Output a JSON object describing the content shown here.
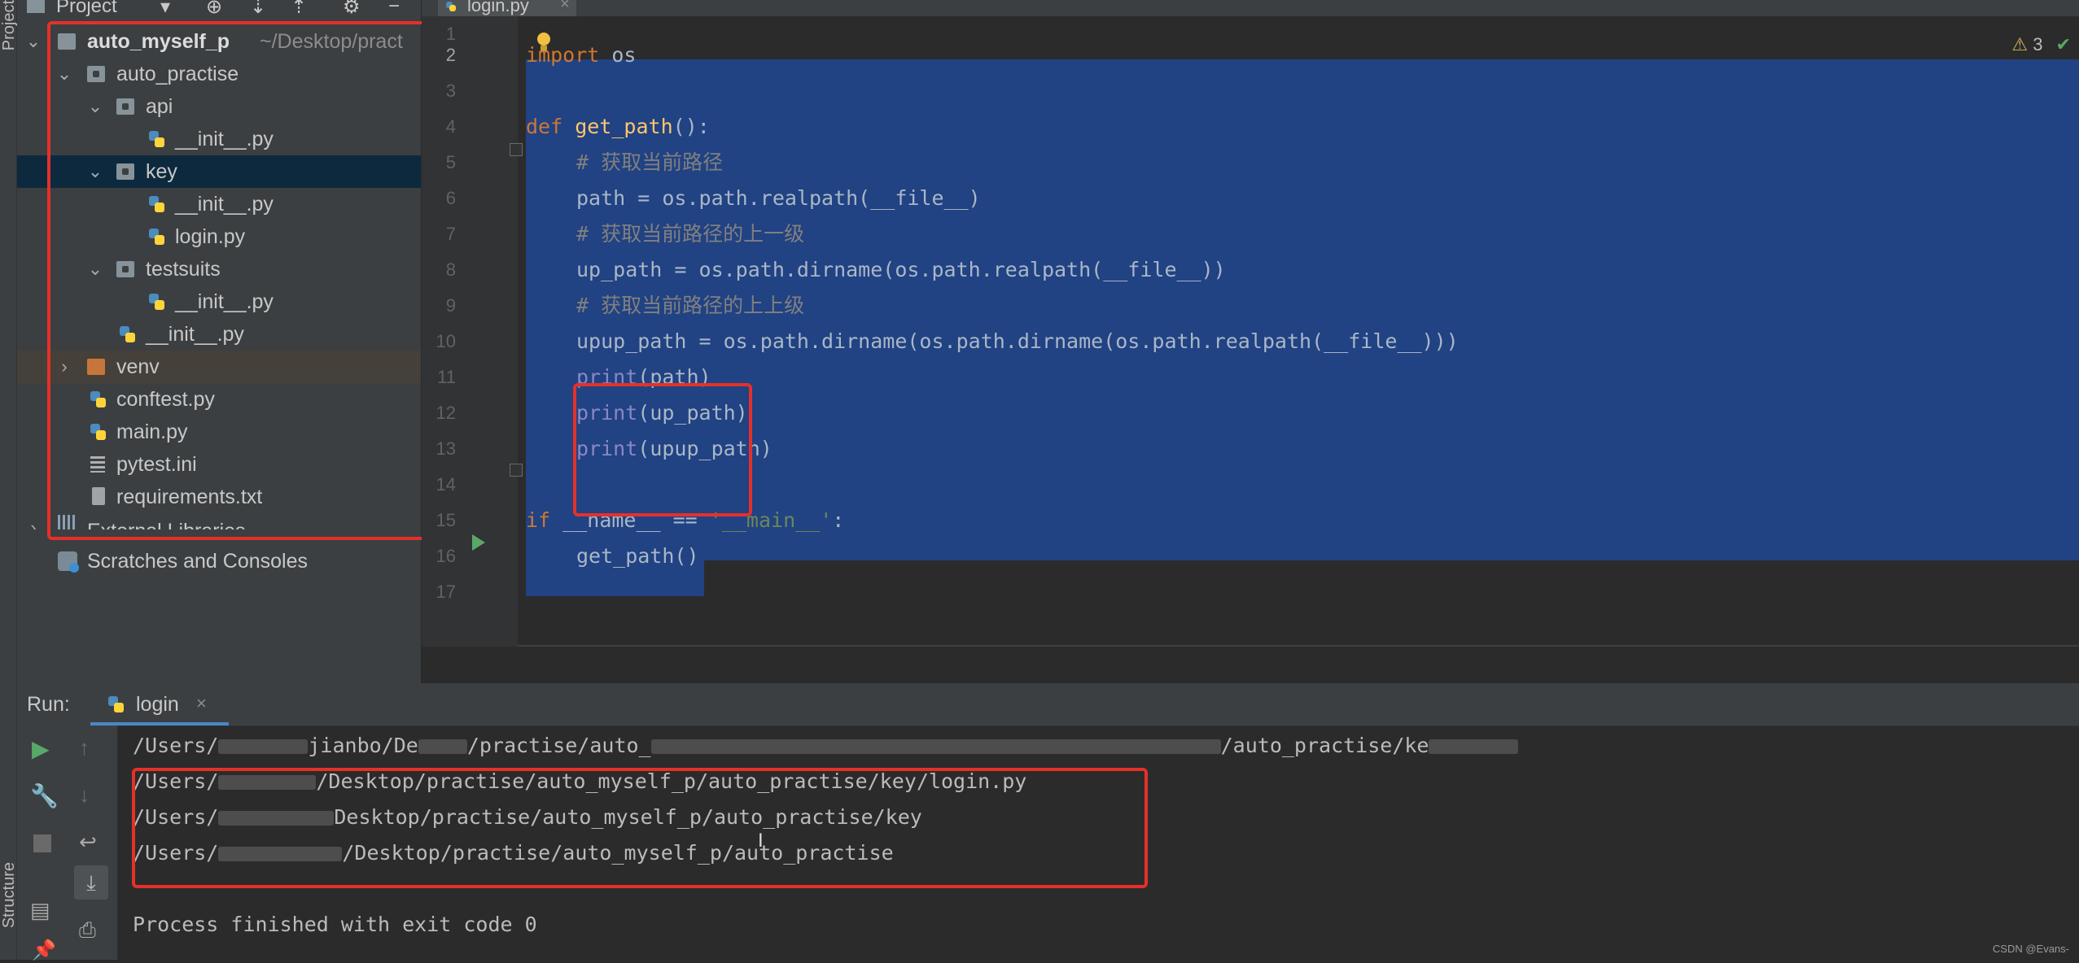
{
  "toolwindow": {
    "left_tabs": [
      "Project",
      "Structure"
    ]
  },
  "project_panel": {
    "header": {
      "title": "Project"
    },
    "tree": [
      {
        "label": "auto_myself_p",
        "hint": "~/Desktop/pract",
        "level": 0,
        "kind": "folder",
        "expanded": true
      },
      {
        "label": "auto_practise",
        "level": 1,
        "kind": "module-folder",
        "expanded": true
      },
      {
        "label": "api",
        "level": 2,
        "kind": "module-folder",
        "expanded": true
      },
      {
        "label": "__init__.py",
        "level": 3,
        "kind": "py"
      },
      {
        "label": "key",
        "level": 2,
        "kind": "module-folder",
        "expanded": true,
        "selected": true
      },
      {
        "label": "__init__.py",
        "level": 3,
        "kind": "py"
      },
      {
        "label": "login.py",
        "level": 3,
        "kind": "py"
      },
      {
        "label": "testsuits",
        "level": 2,
        "kind": "module-folder",
        "expanded": true
      },
      {
        "label": "__init__.py",
        "level": 3,
        "kind": "py"
      },
      {
        "label": "__init__.py",
        "level": 2,
        "kind": "py"
      },
      {
        "label": "venv",
        "level": 1,
        "kind": "orange-folder",
        "expanded": false
      },
      {
        "label": "conftest.py",
        "level": 1,
        "kind": "py"
      },
      {
        "label": "main.py",
        "level": 1,
        "kind": "py"
      },
      {
        "label": "pytest.ini",
        "level": 1,
        "kind": "ini"
      },
      {
        "label": "requirements.txt",
        "level": 1,
        "kind": "txt"
      },
      {
        "label": "External Libraries",
        "level": 0,
        "kind": "lib",
        "expanded": false
      },
      {
        "label": "Scratches and Consoles",
        "level": 0,
        "kind": "scratch"
      }
    ]
  },
  "editor": {
    "tab_label": "login.py",
    "inspection_count": "3",
    "line_numbers": [
      "1",
      "2",
      "3",
      "4",
      "5",
      "6",
      "7",
      "8",
      "9",
      "10",
      "11",
      "12",
      "13",
      "14",
      "15",
      "16",
      "17"
    ],
    "lines": {
      "l2_kw": "import",
      "l2_rest": " os",
      "l4_kw": "def",
      "l4_fn": "get_path",
      "l4_rest": "():",
      "l5": "# 获取当前路径",
      "l6": "path = os.path.realpath(__file__)",
      "l7": "# 获取当前路径的上一级",
      "l8": "up_path = os.path.dirname(os.path.realpath(__file__))",
      "l9": "# 获取当前路径的上上级",
      "l10": "upup_path = os.path.dirname(os.path.dirname(os.path.realpath(__file__)))",
      "l11_bi": "print",
      "l11_rest": "(path)",
      "l12_bi": "print",
      "l12_rest": "(up_path)",
      "l13_bi": "print",
      "l13_rest": "(upup_path)",
      "l15_kw": "if",
      "l15_mid": " __name__ == ",
      "l15_str": "'__main__'",
      "l15_end": ":",
      "l16": "get_path()"
    }
  },
  "run_panel": {
    "label": "Run:",
    "config_name": "login",
    "output": {
      "cmd_a": "/Users/",
      "cmd_b": "jianbo/De",
      "cmd_c": "/practise/auto_",
      "cmd_d": "/auto_practise/ke",
      "line1_a": "/Users/",
      "line1_b": "/Desktop/practise/auto_myself_p/auto_practise/key/login.py",
      "line2_a": "/Users/",
      "line2_b": "Desktop/practise/auto_myself_p/auto_practise/key",
      "line3_a": "/Users/",
      "line3_b": "/Desktop/practise/auto_myself_p/auto_practise",
      "exit": "Process finished with exit code 0"
    }
  },
  "watermark": "CSDN @Evans-",
  "colors": {
    "annotation_red": "#e5302a",
    "selection": "#214283"
  }
}
